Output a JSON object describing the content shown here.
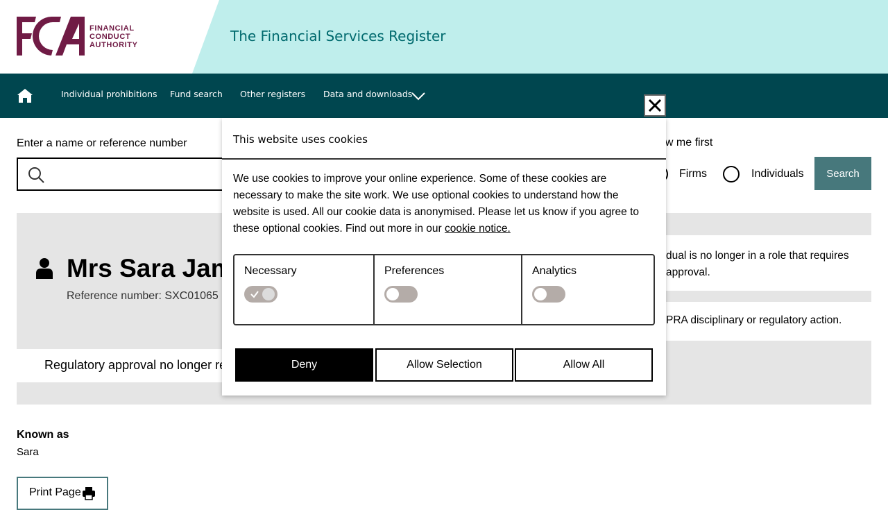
{
  "header": {
    "logo_lines": [
      "FINANCIAL",
      "CONDUCT",
      "AUTHORITY"
    ],
    "site_title": "The Financial Services Register"
  },
  "nav": {
    "items": [
      "Individual prohibitions",
      "Fund search",
      "Other registers",
      "Data and downloads"
    ]
  },
  "search": {
    "label": "Enter a name or reference number",
    "show_first_label": "ow me first",
    "options": [
      "Firms",
      "Individuals"
    ],
    "button_label": "Search"
  },
  "profile": {
    "name": "Mrs Sara Jam",
    "reference": "Reference number: SXC01065",
    "status": "Regulatory approval no longer re",
    "right_notice_1": "dual is no longer in a role that requires approval.",
    "right_notice_2": "PRA disciplinary or regulatory action."
  },
  "known_as": {
    "label": "Known as",
    "value": "Sara"
  },
  "print": {
    "label": "Print Page"
  },
  "cookie": {
    "title": "This website uses cookies",
    "body": "We use cookies to improve your online experience. Some of these cookies are necessary to make the site work. We use optional cookies to understand how the website is used. All our cookie data is anonymised. Please let us know if you agree to these optional cookies. Find out more in our ",
    "link": "cookie notice.",
    "options": [
      {
        "label": "Necessary",
        "enabled": true
      },
      {
        "label": "Preferences",
        "enabled": false
      },
      {
        "label": "Analytics",
        "enabled": false
      }
    ],
    "buttons": {
      "deny": "Deny",
      "allow_selection": "Allow Selection",
      "allow_all": "Allow All"
    }
  },
  "colors": {
    "brand": "#701b45",
    "header_bg": "#bfeeec",
    "nav_bg": "#00464f",
    "accent": "#47787c"
  },
  "icons": [
    "home-icon",
    "chevron-down-icon",
    "close-icon",
    "search-icon",
    "person-icon",
    "printer-icon",
    "check-icon"
  ]
}
